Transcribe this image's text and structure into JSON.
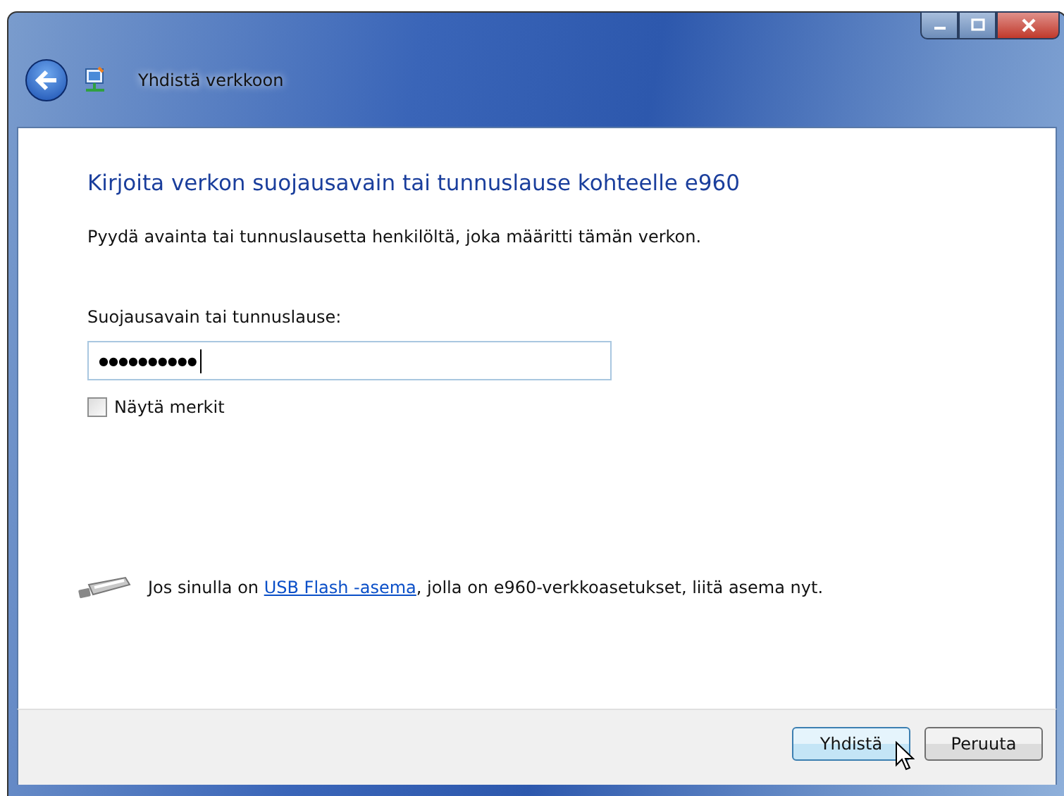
{
  "window": {
    "title": "Yhdistä verkkoon"
  },
  "heading": "Kirjoita verkon suojausavain tai tunnuslause kohteelle e960",
  "instruction": "Pyydä avainta tai tunnuslausetta henkilöltä, joka määritti tämän verkon.",
  "key_field": {
    "label": "Suojausavain tai tunnuslause:",
    "value": "●●●●●●●●●●"
  },
  "show_characters": {
    "label": "Näytä merkit",
    "checked": false
  },
  "usb_hint": {
    "before": "Jos sinulla on ",
    "link": "USB Flash -asema",
    "after": ", jolla on e960-verkkoasetukset, liitä asema nyt."
  },
  "buttons": [
    {
      "label": "Yhdistä",
      "default": true
    },
    {
      "label": "Peruuta",
      "default": false
    }
  ]
}
